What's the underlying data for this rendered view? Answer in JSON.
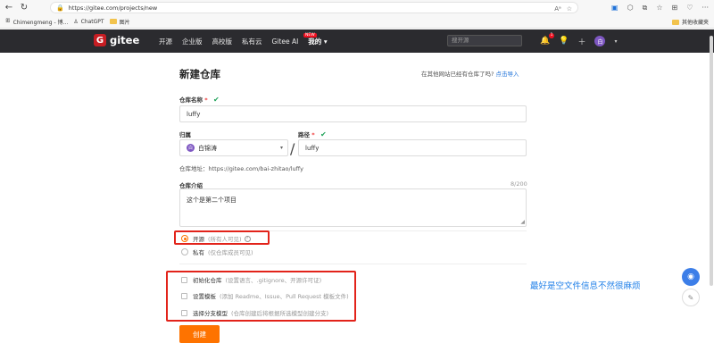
{
  "browser": {
    "url": "https://gitee.com/projects/new",
    "bookmarks": [
      "Chimengmeng - 博...",
      "ChatGPT",
      "图片"
    ],
    "other_bookmarks": "其他收藏夹"
  },
  "header": {
    "logo": "gitee",
    "nav": [
      "开源",
      "企业版",
      "高校版",
      "私有云",
      "Gitee AI",
      "我的 ▾"
    ],
    "new_tag": "NEW",
    "search_placeholder": "搜开源",
    "notify_count": "1",
    "avatar_initial": "白"
  },
  "main": {
    "title": "新建仓库",
    "import_hint": "在其他网站已经有仓库了吗?",
    "import_link": "点击导入",
    "repo_name_label": "仓库名称",
    "repo_name_value": "luffy",
    "owner_label": "归属",
    "owner_value": "白锦涛",
    "owner_initial": "白",
    "path_label": "路径",
    "path_value": "luffy",
    "repo_address": "仓库地址：https://gitee.com/bai-zhitao/luffy",
    "desc_label": "仓库介绍",
    "desc_counter": "8/200",
    "desc_value": "这个是第二个项目",
    "visibility": [
      {
        "label": "开源",
        "hint": "(所有人可见)",
        "checked": true
      },
      {
        "label": "私有",
        "hint": "(仅仓库成员可见)",
        "checked": false
      }
    ],
    "options": [
      {
        "label": "初始化仓库",
        "hint": "(设置语言、.gitignore、开源许可证)"
      },
      {
        "label": "设置模板",
        "hint": "(添加 Readme、Issue、Pull Request 模板文件)"
      },
      {
        "label": "选择分支模型",
        "hint": "(仓库创建后将根据所选模型创建分支)"
      }
    ],
    "annotation": "最好是空文件信息不然很麻烦",
    "create_button": "创建"
  },
  "colors": {
    "accent": "#fe7300",
    "header_bg": "#2b2b2f",
    "highlight_box": "#e2231a",
    "annotation": "#1f7fe8"
  }
}
